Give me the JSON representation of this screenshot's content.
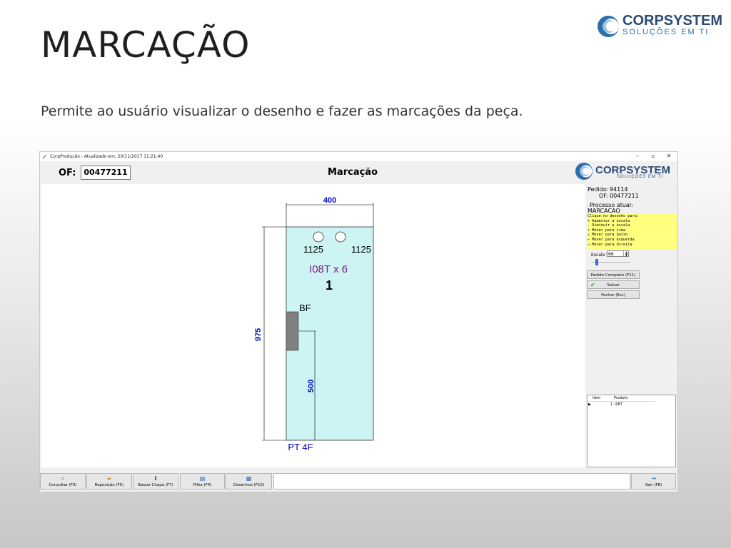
{
  "slide": {
    "title": "MARCAÇÃO",
    "subtitle": "Permite ao usuário visualizar o desenho e fazer as marcações da peça.",
    "brand_name": "CORPSYSTEM",
    "brand_tagline": "SOLUÇÕES EM TI",
    "brand_color": "#2c4a73"
  },
  "window": {
    "title": "CorpProdução - Atualizado em: 20/11/2017 11:21:40",
    "controls": {
      "minimize": "–",
      "maximize": "▫",
      "close": "✕"
    }
  },
  "header": {
    "of_label": "OF:",
    "of_value": "00477211",
    "form_title": "Marcação",
    "logo_name": "CORPSYSTEM",
    "logo_tagline": "SOLUÇÕES EM TI"
  },
  "drawing": {
    "width_dim": "400",
    "height_dim": "975",
    "offset_dim": "500",
    "hole_labels": [
      "1125",
      "1125"
    ],
    "part_code": "I08T x 6",
    "part_number": "1",
    "marker_label": "BF",
    "footer_label": "PT 4F",
    "panel_color": "#cdf4f4",
    "dim_color": "#0000cc"
  },
  "side": {
    "pedido_label": "Pedido:",
    "pedido_value": "94114",
    "of_label": "OF:",
    "of_value": "00477211",
    "processo_label": "Processo atual:",
    "processo_value": "MARCACAO",
    "help_lines": [
      "Clique no desenho para:",
      "+  Aumentar a escala",
      "-  Diminuir a escala",
      "↑  Mover para cima",
      "↓  Mover para baixo",
      "←  Mover para esquerda",
      "→  Mover para direita"
    ],
    "scale_label": "Escala %",
    "scale_value": "66",
    "scale_slider_fraction": 0.12,
    "btn_pedido": "Pedido Completo (F11)",
    "btn_salvar": "Salvar",
    "btn_fechar": "Fechar (Esc)",
    "grid_headers": [
      "Item",
      "Produto"
    ],
    "grid_rows": [
      [
        "1",
        "I08T"
      ]
    ]
  },
  "toolbar": {
    "consultar": "Consultar (F3)",
    "reposicao": "Reposição (F5)",
    "baixar": "Baixar Chapa (F7)",
    "pilha": "Pilha (F4)",
    "desenhos": "Desenhos (F10)",
    "sair": "Sair (F8)"
  }
}
